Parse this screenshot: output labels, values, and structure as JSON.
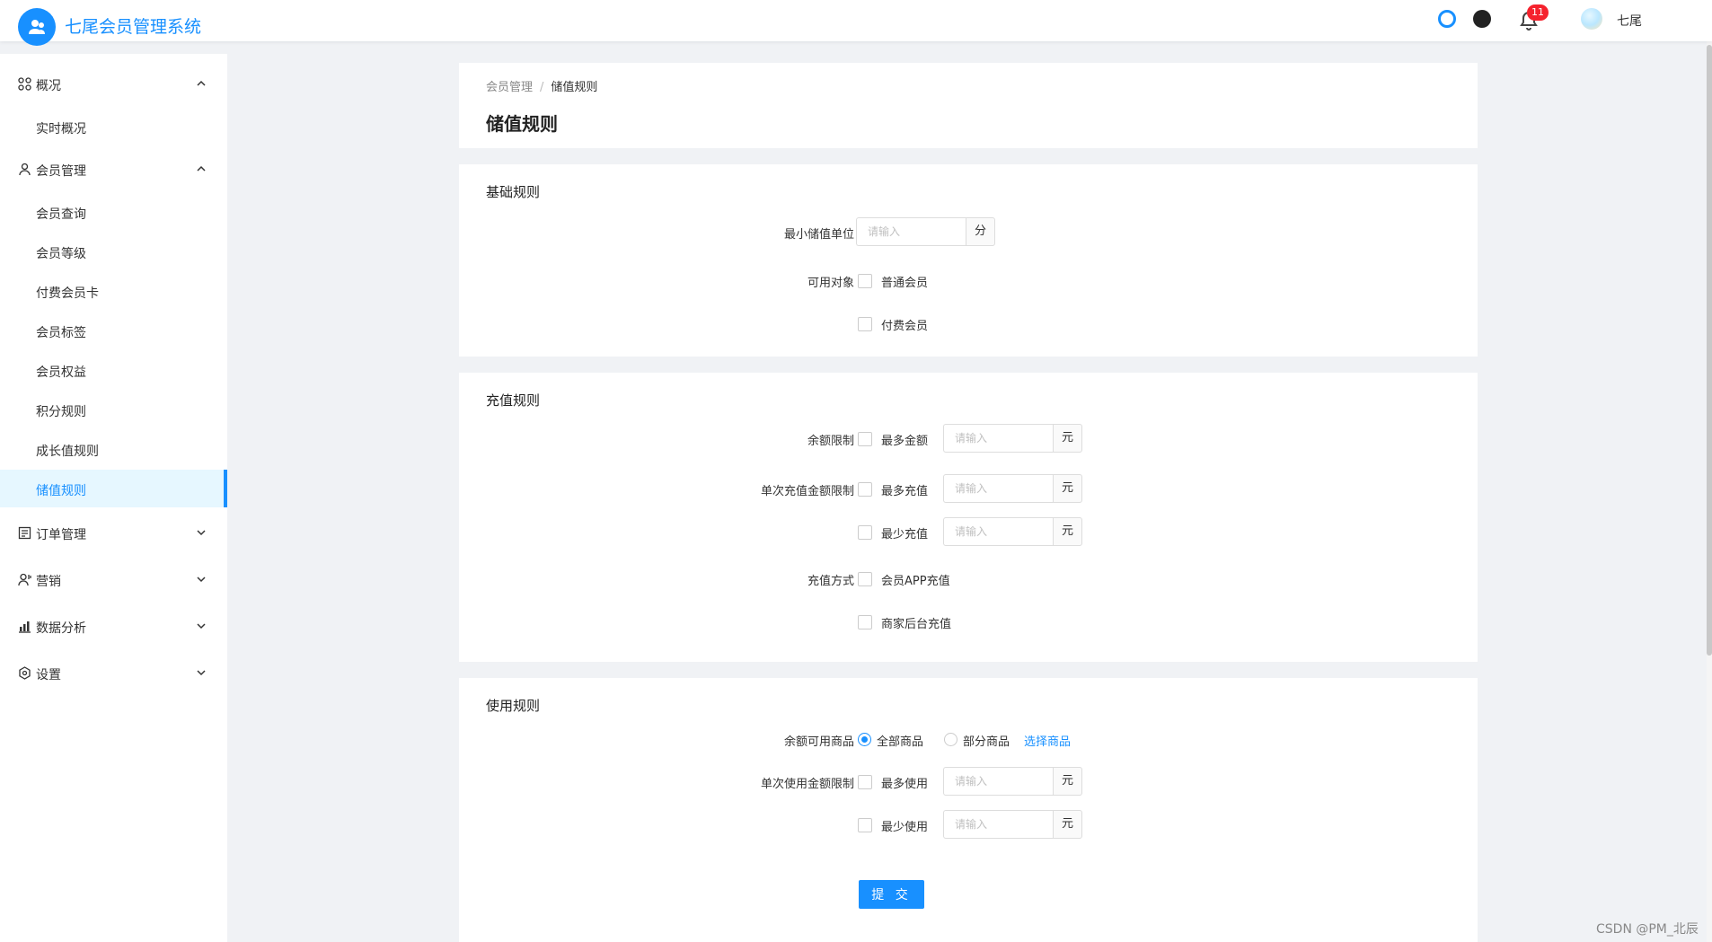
{
  "header": {
    "app_title": "七尾会员管理系统",
    "notification_count": "11",
    "username": "七尾"
  },
  "sidebar": {
    "groups": [
      {
        "label": "概况",
        "icon": "grid-icon",
        "expanded": true,
        "items": [
          {
            "label": "实时概况"
          }
        ]
      },
      {
        "label": "会员管理",
        "icon": "user-icon",
        "expanded": true,
        "items": [
          {
            "label": "会员查询"
          },
          {
            "label": "会员等级"
          },
          {
            "label": "付费会员卡"
          },
          {
            "label": "会员标签"
          },
          {
            "label": "会员权益"
          },
          {
            "label": "积分规则"
          },
          {
            "label": "成长值规则"
          },
          {
            "label": "储值规则",
            "active": true
          }
        ]
      },
      {
        "label": "订单管理",
        "icon": "order-icon",
        "expanded": false
      },
      {
        "label": "营销",
        "icon": "marketing-icon",
        "expanded": false
      },
      {
        "label": "数据分析",
        "icon": "bar-chart-icon",
        "expanded": false
      },
      {
        "label": "设置",
        "icon": "gear-icon",
        "expanded": false
      }
    ]
  },
  "breadcrumb": {
    "parent": "会员管理",
    "separator": "/",
    "current": "储值规则"
  },
  "page_title": "储值规则",
  "basic": {
    "title": "基础规则",
    "min_unit_label": "最小储值单位",
    "min_unit_placeholder": "请输入",
    "min_unit_suffix": "分",
    "target_label": "可用对象",
    "target_normal": "普通会员",
    "target_paid": "付费会员"
  },
  "recharge": {
    "title": "充值规则",
    "balance_limit_label": "余额限制",
    "balance_max": "最多金额",
    "single_limit_label": "单次充值金额限制",
    "single_max": "最多充值",
    "single_min": "最少充值",
    "method_label": "充值方式",
    "method_app": "会员APP充值",
    "method_backend": "商家后台充值",
    "placeholder": "请输入",
    "suffix": "元"
  },
  "usage": {
    "title": "使用规则",
    "goods_label": "余额可用商品",
    "goods_all": "全部商品",
    "goods_partial": "部分商品",
    "select_goods": "选择商品",
    "single_limit_label": "单次使用金额限制",
    "use_max": "最多使用",
    "use_min": "最少使用",
    "placeholder": "请输入",
    "suffix": "元"
  },
  "submit_label": "提 交",
  "watermark": "CSDN @PM_北辰"
}
